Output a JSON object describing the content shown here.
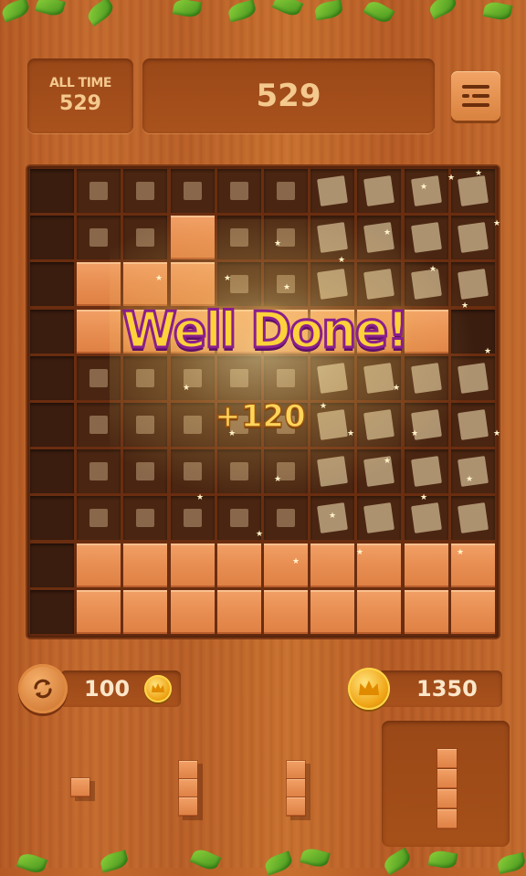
{
  "header": {
    "all_time_label": "ALL TIME",
    "all_time_value": "529",
    "score": "529",
    "menu_icon": "menu-list-icon"
  },
  "board": {
    "size": 10,
    "rows": [
      "EGGGGGBBBB",
      "EGGFGGBBBB",
      "EFFFGGBBBB",
      "EFFFFFFFFE",
      "EGGGGGBBBB",
      "EGGGGGBBBB",
      "EGGGGGBBBB",
      "EGGGGGBBBB",
      "EFFFFFFFFF",
      "EFFFFFFFFF"
    ],
    "legend": {
      "E": "empty",
      "F": "filled",
      "G": "clearing",
      "B": "clearing-bright"
    }
  },
  "effects": {
    "message": "Well Done!",
    "points": "+120"
  },
  "bottom": {
    "refresh_icon": "refresh-icon",
    "refresh_cost": "100",
    "coin_icon": "crown-coin-icon",
    "coins": "1350"
  },
  "pieces": [
    {
      "name": "single-block",
      "cells": 1,
      "orientation": "square"
    },
    {
      "name": "vertical-3",
      "cells": 3,
      "orientation": "vertical"
    },
    {
      "name": "vertical-3",
      "cells": 3,
      "orientation": "vertical"
    },
    {
      "name": "vertical-4",
      "cells": 4,
      "orientation": "vertical",
      "selected": true
    }
  ],
  "colors": {
    "wood": "#c46a2e",
    "block": "#e88e52",
    "empty_cell": "#3b1d0f",
    "message_fill": "#ffd23a",
    "message_outline": "#8a1f8c",
    "coin": "#f0a516"
  }
}
